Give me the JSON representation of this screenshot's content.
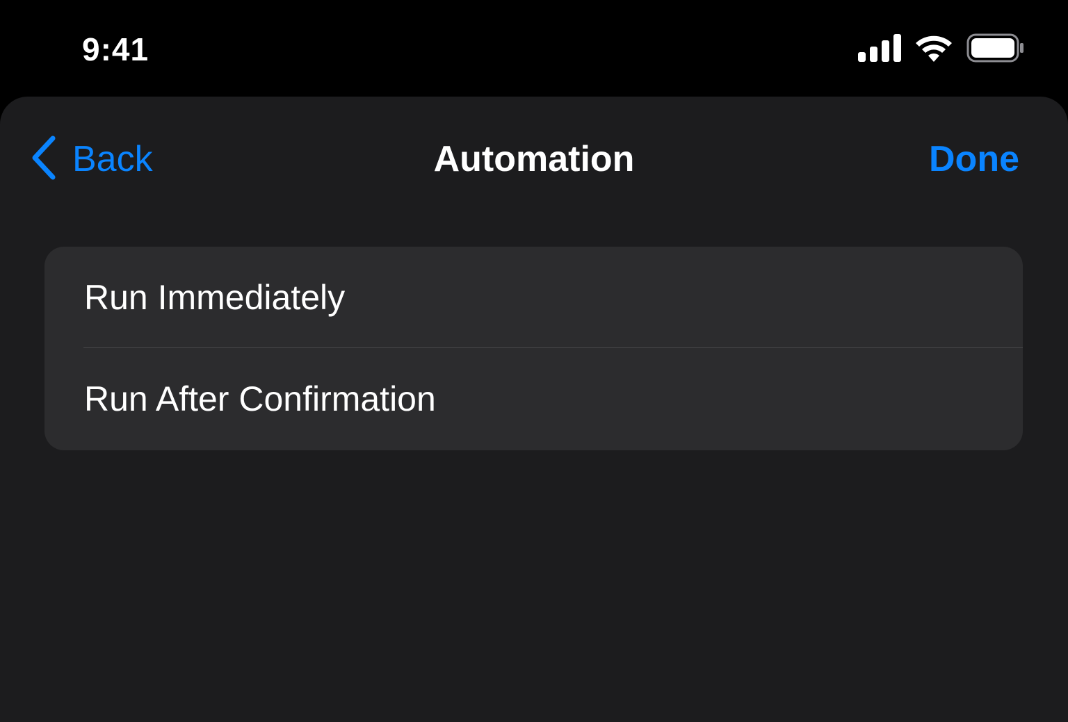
{
  "status_bar": {
    "time": "9:41",
    "icons": [
      "cellular-signal-icon",
      "wifi-icon",
      "battery-icon"
    ]
  },
  "nav": {
    "back_label": "Back",
    "back_icon": "chevron-left-icon",
    "title": "Automation",
    "done_label": "Done"
  },
  "options": [
    {
      "label": "Run Immediately"
    },
    {
      "label": "Run After Confirmation"
    }
  ],
  "colors": {
    "accent": "#0a84ff",
    "background": "#000000",
    "sheet": "#1c1c1e",
    "group": "#2c2c2e",
    "separator": "#48484a",
    "text": "#ffffff"
  }
}
